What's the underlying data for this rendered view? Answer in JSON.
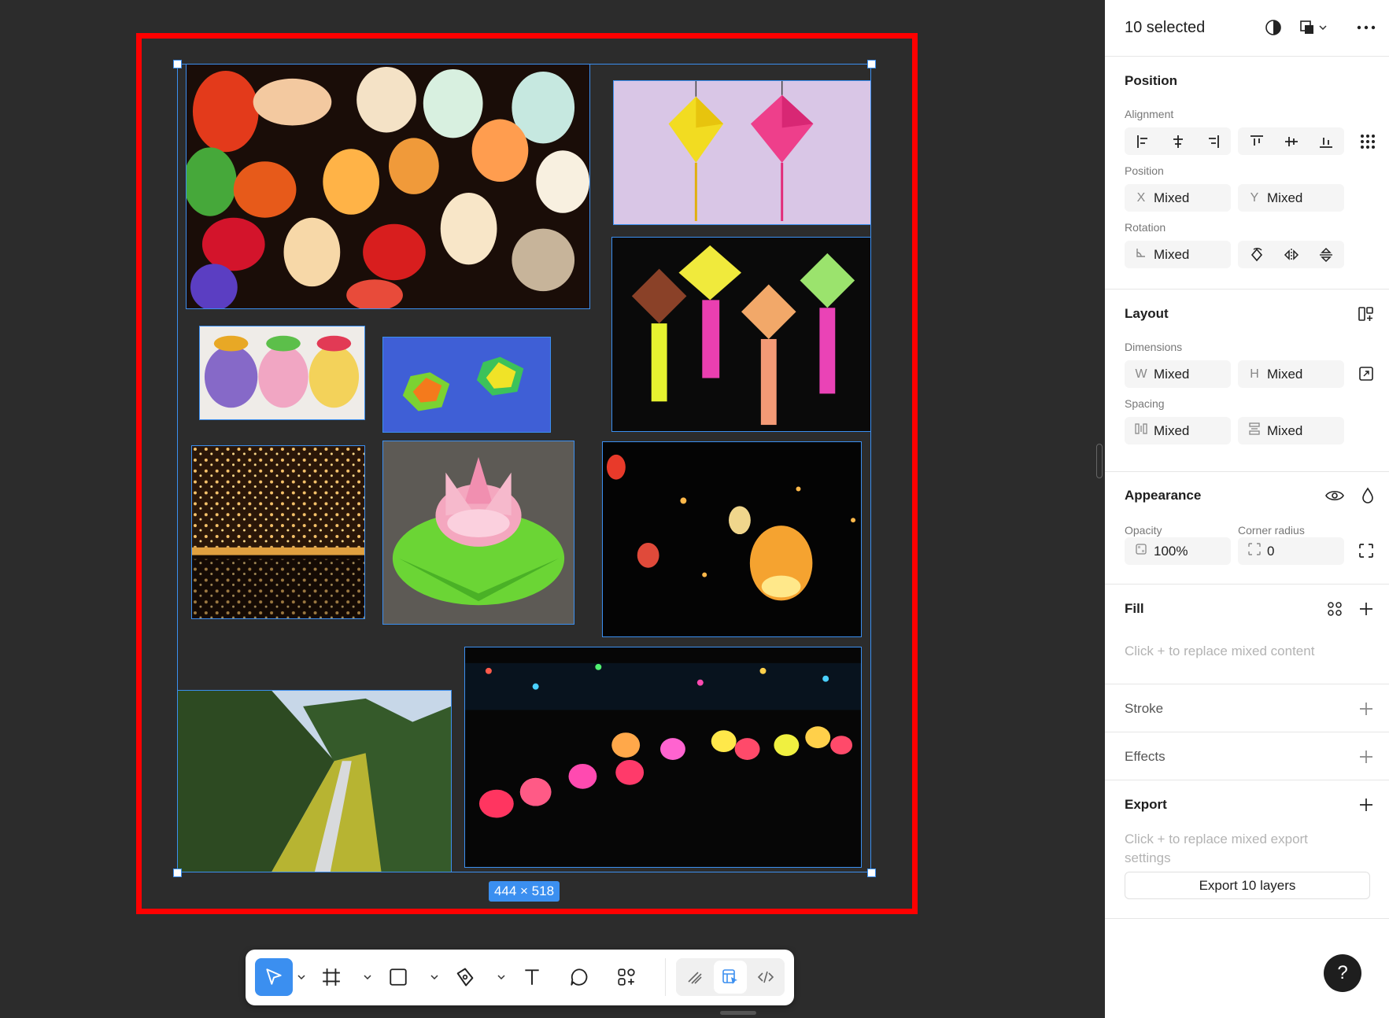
{
  "canvas": {
    "selection_size": "444 × 518",
    "images": [
      {
        "name": "image-hanging-silk-lanterns"
      },
      {
        "name": "image-origami-hanging-lanterns-pink"
      },
      {
        "name": "image-origami-hanging-lanterns-tassels"
      },
      {
        "name": "image-paper-lotus-lanterns"
      },
      {
        "name": "image-origami-stars-blue"
      },
      {
        "name": "image-sky-lanterns-night"
      },
      {
        "name": "image-paper-lotus-leaf"
      },
      {
        "name": "image-floating-sky-lantern"
      },
      {
        "name": "image-valley-river-landscape"
      },
      {
        "name": "image-floating-water-lanterns"
      }
    ]
  },
  "toolbar": {
    "tools": [
      {
        "name": "move-tool",
        "icon": "cursor-icon",
        "active": true
      },
      {
        "name": "frame-tool",
        "icon": "hash-frame-icon"
      },
      {
        "name": "shape-tool",
        "icon": "rectangle-icon"
      },
      {
        "name": "pen-tool",
        "icon": "pen-icon"
      },
      {
        "name": "text-tool",
        "icon": "text-icon"
      },
      {
        "name": "comment-tool",
        "icon": "comment-icon"
      },
      {
        "name": "assets-tool",
        "icon": "components-icon"
      }
    ],
    "modes": [
      {
        "name": "draw-mode",
        "icon": "draw-icon"
      },
      {
        "name": "design-mode",
        "icon": "design-icon",
        "active": true
      },
      {
        "name": "dev-mode",
        "icon": "code-icon"
      }
    ]
  },
  "panel": {
    "header": {
      "title": "10 selected"
    },
    "position": {
      "title": "Position",
      "alignment_label": "Alignment",
      "position_label": "Position",
      "x_prefix": "X",
      "x_value": "Mixed",
      "y_prefix": "Y",
      "y_value": "Mixed",
      "rotation_label": "Rotation",
      "rotation_value": "Mixed"
    },
    "layout": {
      "title": "Layout",
      "dimensions_label": "Dimensions",
      "w_prefix": "W",
      "w_value": "Mixed",
      "h_prefix": "H",
      "h_value": "Mixed",
      "spacing_label": "Spacing",
      "h_spacing_value": "Mixed",
      "v_spacing_value": "Mixed"
    },
    "appearance": {
      "title": "Appearance",
      "opacity_label": "Opacity",
      "opacity_value": "100%",
      "corner_label": "Corner radius",
      "corner_value": "0"
    },
    "fill": {
      "title": "Fill",
      "hint": "Click + to replace mixed content"
    },
    "stroke": {
      "title": "Stroke"
    },
    "effects": {
      "title": "Effects"
    },
    "export": {
      "title": "Export",
      "hint_line1": "Click + to replace mixed export",
      "hint_line2": "settings",
      "button": "Export 10 layers"
    },
    "help": "?"
  },
  "colors": {
    "canvas_bg": "#2c2c2c",
    "selection": "#3b8ff0",
    "frame_outline": "#ff0000",
    "panel_bg": "#ffffff"
  }
}
